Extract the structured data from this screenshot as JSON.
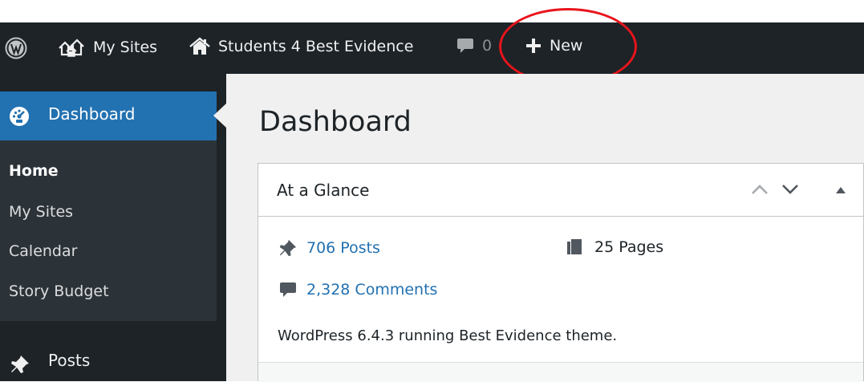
{
  "admin_bar": {
    "wp_logo_icon": "wordpress-logo-icon",
    "my_sites_label": "My Sites",
    "my_sites_icon": "my-sites-icon",
    "site_name": "Students 4 Best Evidence",
    "site_icon": "home-icon",
    "comments_icon": "comment-bubble-icon",
    "comments_count": "0",
    "new_icon": "plus-icon",
    "new_label": "New",
    "highlight_color": "#e8141c"
  },
  "sidebar": {
    "dashboard": {
      "label": "Dashboard",
      "icon": "dashboard-gauge-icon",
      "active_color": "#2271b1"
    },
    "submenu": [
      {
        "label": "Home",
        "current": true
      },
      {
        "label": "My Sites",
        "current": false
      },
      {
        "label": "Calendar",
        "current": false
      },
      {
        "label": "Story Budget",
        "current": false
      }
    ],
    "posts": {
      "label": "Posts",
      "icon": "pushpin-icon"
    }
  },
  "main": {
    "page_title": "Dashboard",
    "at_a_glance": {
      "title": "At a Glance",
      "controls": [
        "move-up-icon",
        "move-down-icon",
        "toggle-panel-icon"
      ],
      "posts": "706 Posts",
      "pages": "25 Pages",
      "comments": "2,328 Comments",
      "version_text": "WordPress 6.4.3 running Best Evidence theme."
    }
  }
}
